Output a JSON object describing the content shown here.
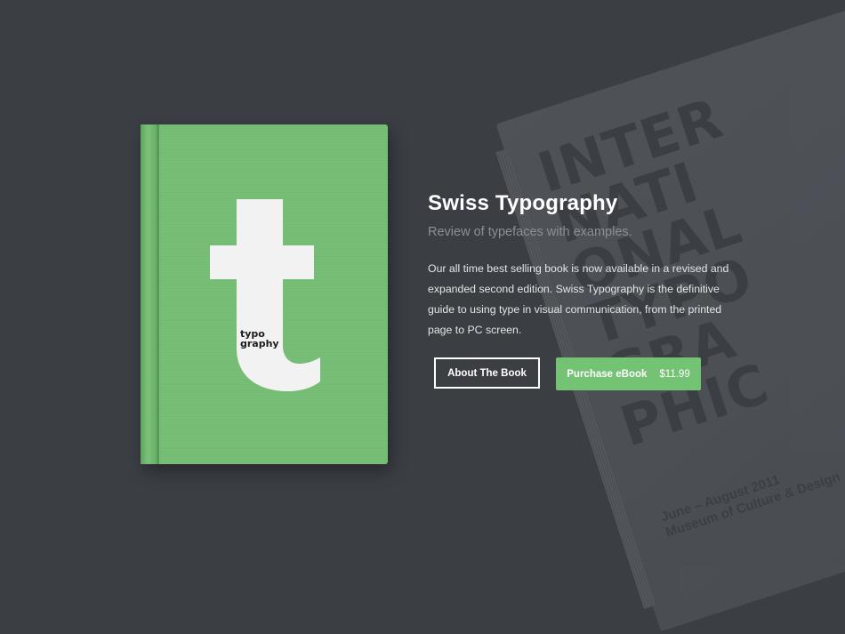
{
  "book": {
    "cover_label_line1": "typo",
    "cover_label_line2": "graphy",
    "cover_color": "#74bb74"
  },
  "background_book": {
    "lines": [
      "INTER",
      "NATI",
      "ONAL",
      "TYPO",
      "GRA",
      "PHIC"
    ],
    "footer_line1": "June – August 2011",
    "footer_line2": "Museum of Culture & Design"
  },
  "content": {
    "title": "Swiss Typography",
    "subtitle": "Review of typefaces with examples.",
    "description": "Our all time best selling book is now available in a revised and expanded second edition. Swiss Typography is the definitive guide to using type in visual communication, from the printed page to PC screen."
  },
  "buttons": {
    "about_label": "About The Book",
    "purchase_label": "Purchase eBook",
    "purchase_price": "$11.99"
  },
  "colors": {
    "background": "#3b3e43",
    "accent_green": "#74c274"
  }
}
